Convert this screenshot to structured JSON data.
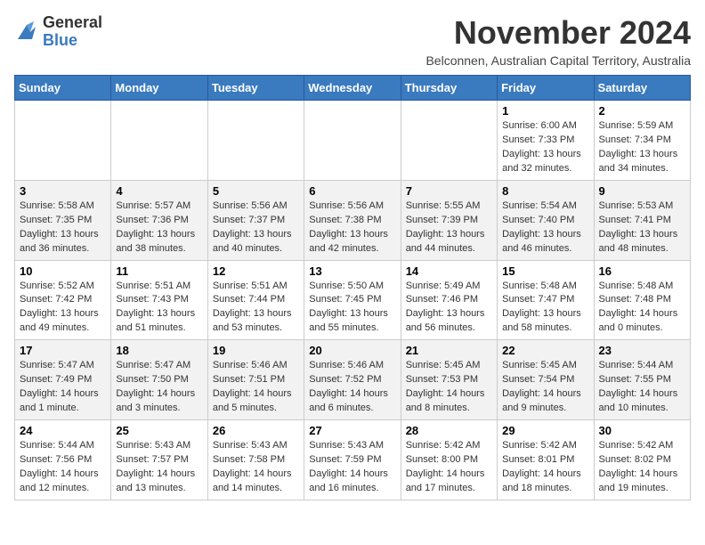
{
  "header": {
    "logo": {
      "general": "General",
      "blue": "Blue"
    },
    "title": "November 2024",
    "location": "Belconnen, Australian Capital Territory, Australia"
  },
  "calendar": {
    "days_of_week": [
      "Sunday",
      "Monday",
      "Tuesday",
      "Wednesday",
      "Thursday",
      "Friday",
      "Saturday"
    ],
    "weeks": [
      [
        {
          "day": "",
          "detail": ""
        },
        {
          "day": "",
          "detail": ""
        },
        {
          "day": "",
          "detail": ""
        },
        {
          "day": "",
          "detail": ""
        },
        {
          "day": "",
          "detail": ""
        },
        {
          "day": "1",
          "detail": "Sunrise: 6:00 AM\nSunset: 7:33 PM\nDaylight: 13 hours\nand 32 minutes."
        },
        {
          "day": "2",
          "detail": "Sunrise: 5:59 AM\nSunset: 7:34 PM\nDaylight: 13 hours\nand 34 minutes."
        }
      ],
      [
        {
          "day": "3",
          "detail": "Sunrise: 5:58 AM\nSunset: 7:35 PM\nDaylight: 13 hours\nand 36 minutes."
        },
        {
          "day": "4",
          "detail": "Sunrise: 5:57 AM\nSunset: 7:36 PM\nDaylight: 13 hours\nand 38 minutes."
        },
        {
          "day": "5",
          "detail": "Sunrise: 5:56 AM\nSunset: 7:37 PM\nDaylight: 13 hours\nand 40 minutes."
        },
        {
          "day": "6",
          "detail": "Sunrise: 5:56 AM\nSunset: 7:38 PM\nDaylight: 13 hours\nand 42 minutes."
        },
        {
          "day": "7",
          "detail": "Sunrise: 5:55 AM\nSunset: 7:39 PM\nDaylight: 13 hours\nand 44 minutes."
        },
        {
          "day": "8",
          "detail": "Sunrise: 5:54 AM\nSunset: 7:40 PM\nDaylight: 13 hours\nand 46 minutes."
        },
        {
          "day": "9",
          "detail": "Sunrise: 5:53 AM\nSunset: 7:41 PM\nDaylight: 13 hours\nand 48 minutes."
        }
      ],
      [
        {
          "day": "10",
          "detail": "Sunrise: 5:52 AM\nSunset: 7:42 PM\nDaylight: 13 hours\nand 49 minutes."
        },
        {
          "day": "11",
          "detail": "Sunrise: 5:51 AM\nSunset: 7:43 PM\nDaylight: 13 hours\nand 51 minutes."
        },
        {
          "day": "12",
          "detail": "Sunrise: 5:51 AM\nSunset: 7:44 PM\nDaylight: 13 hours\nand 53 minutes."
        },
        {
          "day": "13",
          "detail": "Sunrise: 5:50 AM\nSunset: 7:45 PM\nDaylight: 13 hours\nand 55 minutes."
        },
        {
          "day": "14",
          "detail": "Sunrise: 5:49 AM\nSunset: 7:46 PM\nDaylight: 13 hours\nand 56 minutes."
        },
        {
          "day": "15",
          "detail": "Sunrise: 5:48 AM\nSunset: 7:47 PM\nDaylight: 13 hours\nand 58 minutes."
        },
        {
          "day": "16",
          "detail": "Sunrise: 5:48 AM\nSunset: 7:48 PM\nDaylight: 14 hours\nand 0 minutes."
        }
      ],
      [
        {
          "day": "17",
          "detail": "Sunrise: 5:47 AM\nSunset: 7:49 PM\nDaylight: 14 hours\nand 1 minute."
        },
        {
          "day": "18",
          "detail": "Sunrise: 5:47 AM\nSunset: 7:50 PM\nDaylight: 14 hours\nand 3 minutes."
        },
        {
          "day": "19",
          "detail": "Sunrise: 5:46 AM\nSunset: 7:51 PM\nDaylight: 14 hours\nand 5 minutes."
        },
        {
          "day": "20",
          "detail": "Sunrise: 5:46 AM\nSunset: 7:52 PM\nDaylight: 14 hours\nand 6 minutes."
        },
        {
          "day": "21",
          "detail": "Sunrise: 5:45 AM\nSunset: 7:53 PM\nDaylight: 14 hours\nand 8 minutes."
        },
        {
          "day": "22",
          "detail": "Sunrise: 5:45 AM\nSunset: 7:54 PM\nDaylight: 14 hours\nand 9 minutes."
        },
        {
          "day": "23",
          "detail": "Sunrise: 5:44 AM\nSunset: 7:55 PM\nDaylight: 14 hours\nand 10 minutes."
        }
      ],
      [
        {
          "day": "24",
          "detail": "Sunrise: 5:44 AM\nSunset: 7:56 PM\nDaylight: 14 hours\nand 12 minutes."
        },
        {
          "day": "25",
          "detail": "Sunrise: 5:43 AM\nSunset: 7:57 PM\nDaylight: 14 hours\nand 13 minutes."
        },
        {
          "day": "26",
          "detail": "Sunrise: 5:43 AM\nSunset: 7:58 PM\nDaylight: 14 hours\nand 14 minutes."
        },
        {
          "day": "27",
          "detail": "Sunrise: 5:43 AM\nSunset: 7:59 PM\nDaylight: 14 hours\nand 16 minutes."
        },
        {
          "day": "28",
          "detail": "Sunrise: 5:42 AM\nSunset: 8:00 PM\nDaylight: 14 hours\nand 17 minutes."
        },
        {
          "day": "29",
          "detail": "Sunrise: 5:42 AM\nSunset: 8:01 PM\nDaylight: 14 hours\nand 18 minutes."
        },
        {
          "day": "30",
          "detail": "Sunrise: 5:42 AM\nSunset: 8:02 PM\nDaylight: 14 hours\nand 19 minutes."
        }
      ]
    ]
  }
}
